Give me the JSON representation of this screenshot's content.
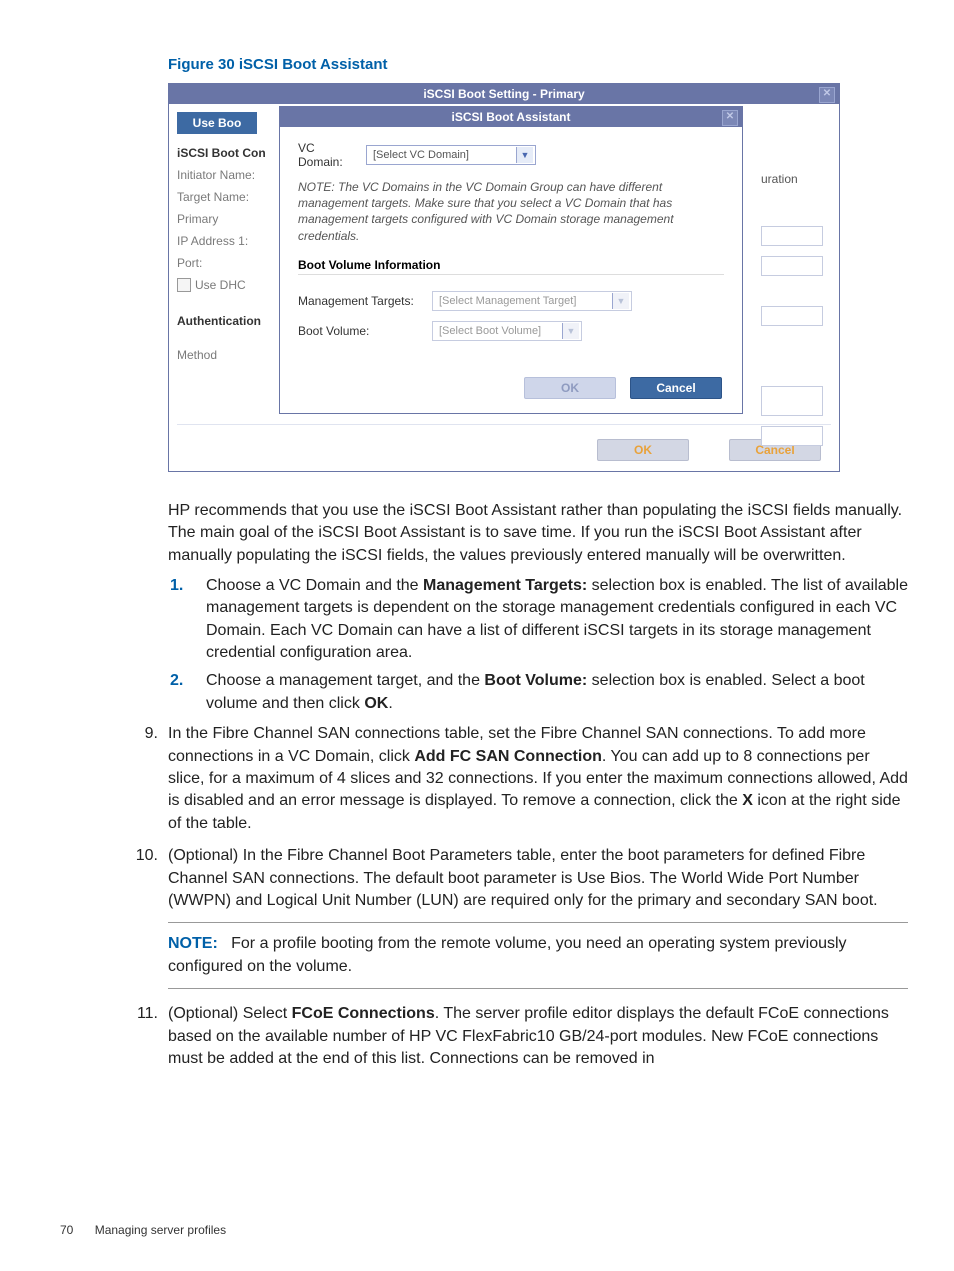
{
  "caption": "Figure 30 iSCSI Boot Assistant",
  "primary": {
    "title": "iSCSI Boot Setting - Primary",
    "useboo": "Use Boo",
    "section1": "iSCSI Boot Con",
    "labels": {
      "initiator": "Initiator Name:",
      "target": "Target Name:",
      "primary": "Primary",
      "ip1": "IP Address 1:",
      "port": "Port:",
      "usedhc": "Use DHC"
    },
    "section2": "Authentication",
    "method": "Method",
    "right_text": "uration",
    "ok": "OK",
    "cancel": "Cancel"
  },
  "assistant": {
    "title": "iSCSI Boot Assistant",
    "vc_label": "VC Domain:",
    "vc_placeholder": "[Select VC Domain]",
    "note": "NOTE: The VC Domains in the VC Domain Group can have different management targets. Make sure that you select a VC Domain that has management targets configured with VC Domain storage management credentials.",
    "bvi": "Boot Volume Information",
    "mgmt_label": "Management Targets:",
    "mgmt_placeholder": "[Select Management Target]",
    "bv_label": "Boot Volume:",
    "bv_placeholder": "[Select Boot Volume]",
    "ok": "OK",
    "cancel": "Cancel"
  },
  "body": {
    "intro": "HP recommends that you use the iSCSI Boot Assistant rather than populating the iSCSI fields manually. The main goal of the iSCSI Boot Assistant is to save time. If you run the iSCSI Boot Assistant after manually populating the iSCSI fields, the values previously entered manually will be overwritten.",
    "sub1_a": "Choose a VC Domain and the ",
    "sub1_b": "Management Targets:",
    "sub1_c": " selection box is enabled. The list of available management targets is dependent on the storage management credentials configured in each VC Domain. Each VC Domain can have a list of different iSCSI targets in its storage management credential configuration area.",
    "sub2_a": "Choose a management target, and the ",
    "sub2_b": "Boot Volume:",
    "sub2_c": " selection box is enabled. Select a boot volume and then click ",
    "sub2_d": "OK",
    "sub2_e": ".",
    "i9_a": "In the Fibre Channel SAN connections table, set the Fibre Channel SAN connections. To add more connections in a VC Domain, click ",
    "i9_b": "Add FC SAN Connection",
    "i9_c": ". You can add up to 8 connections per slice, for a maximum of 4 slices and 32 connections. If you enter the maximum connections allowed, Add is disabled and an error message is displayed. To remove a connection, click the ",
    "i9_d": "X",
    "i9_e": " icon at the right side of the table.",
    "i10": "(Optional) In the Fibre Channel Boot Parameters table, enter the boot parameters for defined Fibre Channel SAN connections. The default boot parameter is Use Bios. The World Wide Port Number (WWPN) and Logical Unit Number (LUN) are required only for the primary and secondary SAN boot.",
    "note_label": "NOTE:",
    "note_text": "For a profile booting from the remote volume, you need an operating system previously configured on the volume.",
    "i11_a": "(Optional) Select ",
    "i11_b": "FCoE Connections",
    "i11_c": ". The server profile editor displays the default FCoE connections based on the available number of HP VC FlexFabric10 GB/24-port modules. New FCoE connections must be added at the end of this list. Connections can be removed in"
  },
  "footer": {
    "page": "70",
    "title": "Managing server profiles"
  },
  "markers": {
    "s1": "1.",
    "s2": "2.",
    "m9": "9.",
    "m10": "10.",
    "m11": "11."
  }
}
